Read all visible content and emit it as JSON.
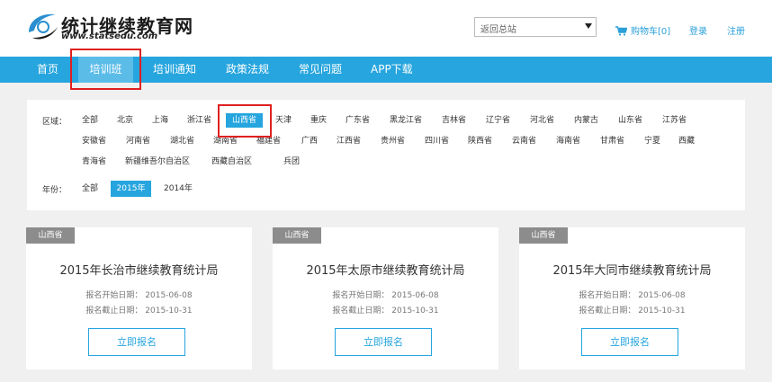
{
  "header": {
    "site_title": "统计继续教育网",
    "site_url": "www.statsedu.com",
    "select_value": "返回总站",
    "cart_label": "购物车[0]",
    "login_label": "登录",
    "register_label": "注册",
    "accent_color": "#26a5de"
  },
  "nav": {
    "items": [
      {
        "label": "首页"
      },
      {
        "label": "培训班"
      },
      {
        "label": "培训通知"
      },
      {
        "label": "政策法规"
      },
      {
        "label": "常见问题"
      },
      {
        "label": "APP下载"
      }
    ],
    "active_label": "培训班"
  },
  "filter": {
    "region_label": "区域：",
    "regions": [
      "全部",
      "北京",
      "上海",
      "浙江省",
      "山西省",
      "天津",
      "重庆",
      "广东省",
      "黑龙江省",
      "吉林省",
      "辽宁省",
      "河北省",
      "内蒙古",
      "山东省",
      "江苏省",
      "安徽省",
      "河南省",
      "湖北省",
      "湖南省",
      "福建省",
      "广西",
      "江西省",
      "贵州省",
      "四川省",
      "陕西省",
      "云南省",
      "海南省",
      "甘肃省",
      "宁夏",
      "西藏",
      "青海省",
      "新疆维吾尔自治区",
      "西藏自治区",
      "兵团"
    ],
    "selected_region": "山西省",
    "year_label": "年份：",
    "years": [
      "全部",
      "2015年",
      "2014年"
    ],
    "selected_year": "2015年"
  },
  "cards": [
    {
      "tag": "山西省",
      "title": "2015年长治市继续教育统计局",
      "start": "报名开始日期： 2015-06-08",
      "end": "报名截止日期： 2015-10-31",
      "button": "立即报名"
    },
    {
      "tag": "山西省",
      "title": "2015年太原市继续教育统计局",
      "start": "报名开始日期： 2015-06-08",
      "end": "报名截止日期： 2015-10-31",
      "button": "立即报名"
    },
    {
      "tag": "山西省",
      "title": "2015年大同市继续教育统计局",
      "start": "报名开始日期： 2015-06-08",
      "end": "报名截止日期： 2015-10-31",
      "button": "立即报名"
    }
  ]
}
